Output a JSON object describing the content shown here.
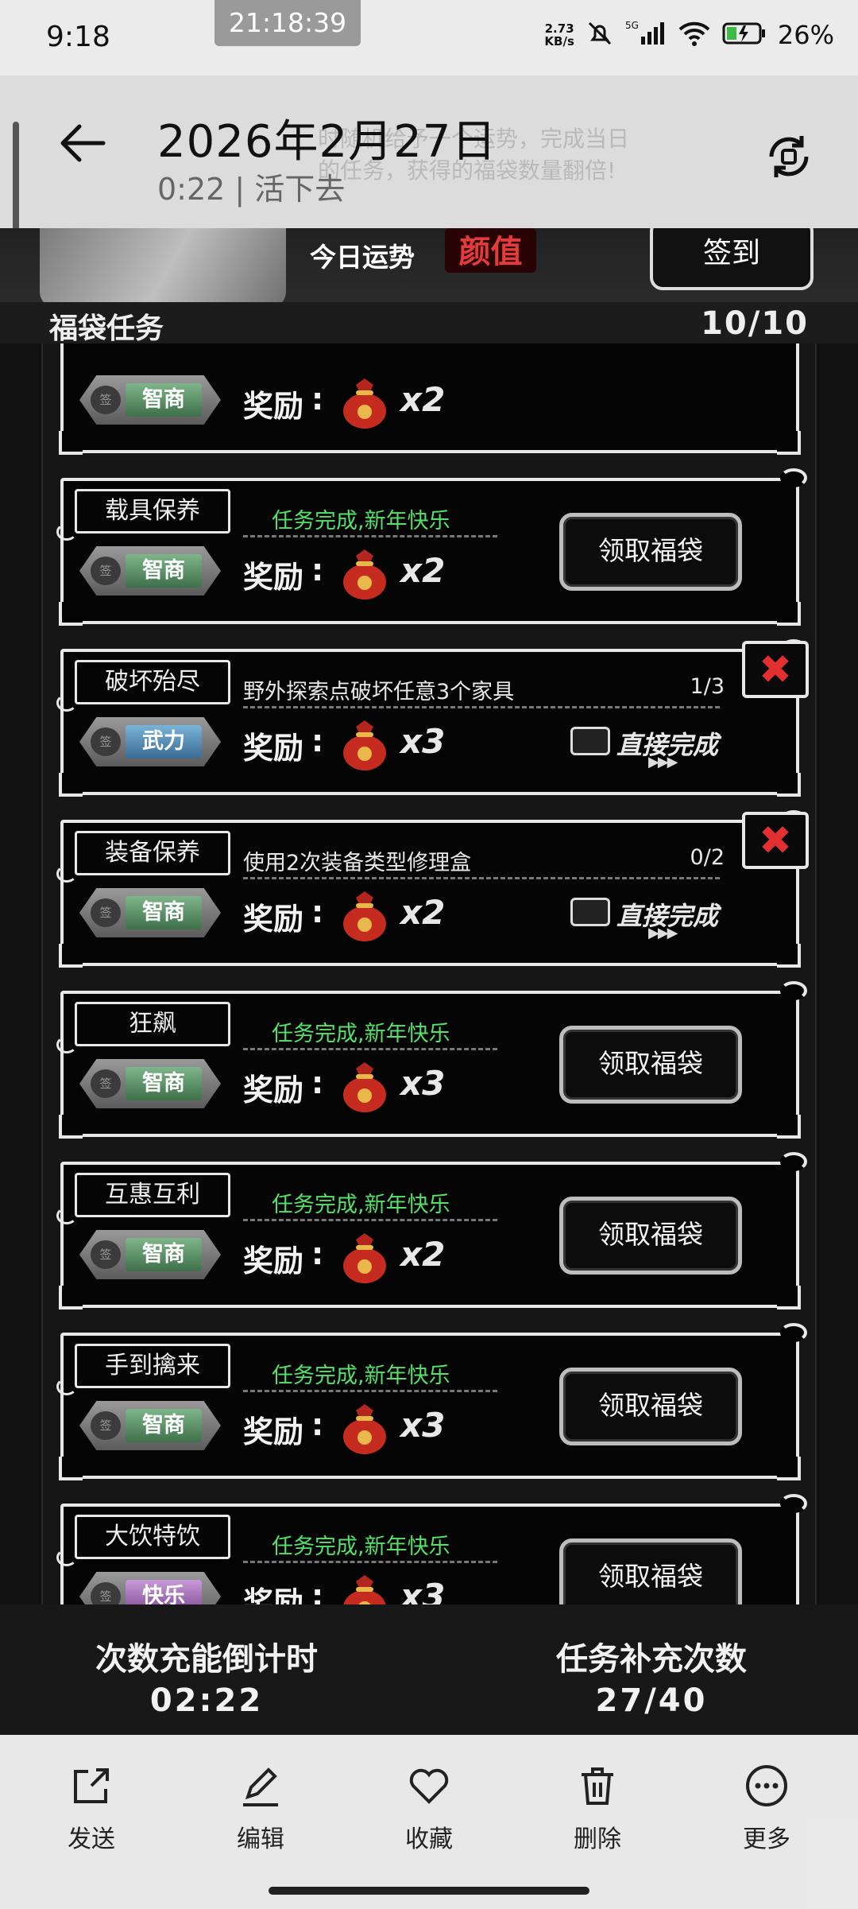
{
  "status_bar": {
    "time": "9:18",
    "recording_clock": "21:18:39",
    "net_speed_top": "2.73",
    "net_speed_bottom": "KB/s",
    "network": "5G",
    "battery_pct": "26%"
  },
  "header": {
    "title": "2026年2月27日",
    "subtitle": "0:22 | 活下去",
    "ghost_text_line1": "时随机给予一个运势，完成当日",
    "ghost_text_line2": "的任务，获得的福袋数量翻倍!"
  },
  "game": {
    "fortune_label": "今日运势",
    "fortune_value": "颜值",
    "sign_in_label": "签到",
    "panel_title": "福袋任务",
    "panel_count": "10/10",
    "reward_label": "奖励",
    "reward_colon": ":",
    "claim_label": "领取福袋",
    "instant_label": "直接完成",
    "seal_text": "签",
    "close_symbol": "✖",
    "tasks": [
      {
        "name": "",
        "desc": "",
        "progress": "",
        "done": false,
        "kind": "智商",
        "kind_color": "green",
        "mult": "x2",
        "partial": true
      },
      {
        "name": "载具保养",
        "desc": "任务完成,新年快乐",
        "progress": "",
        "done": true,
        "kind": "智商",
        "kind_color": "green",
        "mult": "x2"
      },
      {
        "name": "破坏殆尽",
        "desc": "野外探索点破坏任意3个家具",
        "progress": "1/3",
        "done": false,
        "kind": "武力",
        "kind_color": "blue",
        "mult": "x3"
      },
      {
        "name": "装备保养",
        "desc": "使用2次装备类型修理盒",
        "progress": "0/2",
        "done": false,
        "kind": "智商",
        "kind_color": "green",
        "mult": "x2"
      },
      {
        "name": "狂飙",
        "desc": "任务完成,新年快乐",
        "progress": "",
        "done": true,
        "kind": "智商",
        "kind_color": "green",
        "mult": "x3"
      },
      {
        "name": "互惠互利",
        "desc": "任务完成,新年快乐",
        "progress": "",
        "done": true,
        "kind": "智商",
        "kind_color": "green",
        "mult": "x2"
      },
      {
        "name": "手到擒来",
        "desc": "任务完成,新年快乐",
        "progress": "",
        "done": true,
        "kind": "智商",
        "kind_color": "green",
        "mult": "x3"
      },
      {
        "name": "大饮特饮",
        "desc": "任务完成,新年快乐",
        "progress": "",
        "done": true,
        "kind": "快乐",
        "kind_color": "purple",
        "mult": "x3"
      }
    ],
    "recharge_label": "次数充能倒计时",
    "recharge_value": "02:22",
    "refill_label": "任务补充次数",
    "refill_value": "27/40"
  },
  "toolbar": {
    "send": "发送",
    "edit": "编辑",
    "favorite": "收藏",
    "delete": "删除",
    "more": "更多"
  },
  "colors": {
    "done_green": "#55e06a",
    "close_red": "#e23030",
    "fortune_red": "#e23b3b"
  }
}
